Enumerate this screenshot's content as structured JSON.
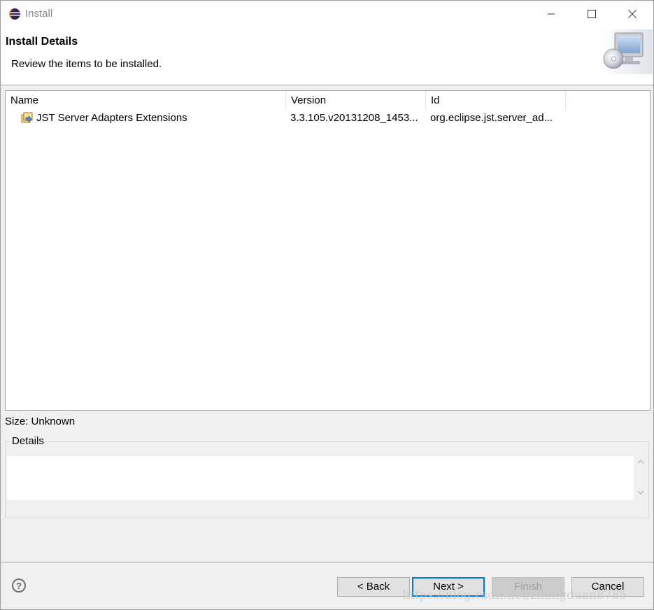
{
  "window": {
    "title": "Install",
    "icon": "eclipse-icon",
    "controls": [
      "minimize-icon",
      "maximize-icon",
      "close-icon"
    ]
  },
  "header": {
    "title": "Install Details",
    "description": "Review the items to be installed.",
    "banner_icon": "install-wizard-icon"
  },
  "table": {
    "columns": [
      "Name",
      "Version",
      "Id"
    ],
    "rows": [
      {
        "icon": "feature-icon",
        "name": "JST Server Adapters Extensions",
        "version": "3.3.105.v20131208_1453...",
        "id": "org.eclipse.jst.server_ad..."
      }
    ]
  },
  "size_label": "Size: Unknown",
  "details": {
    "label": "Details",
    "text": ""
  },
  "buttons": {
    "help_icon": "help-icon",
    "back": "< Back",
    "next": "Next >",
    "finish": "Finish",
    "cancel": "Cancel"
  },
  "watermark": "https://blog.csdn.net/zhangduan8785",
  "colors": {
    "focus_border": "#0078d7",
    "dialog_bg": "#f0f0f0"
  }
}
